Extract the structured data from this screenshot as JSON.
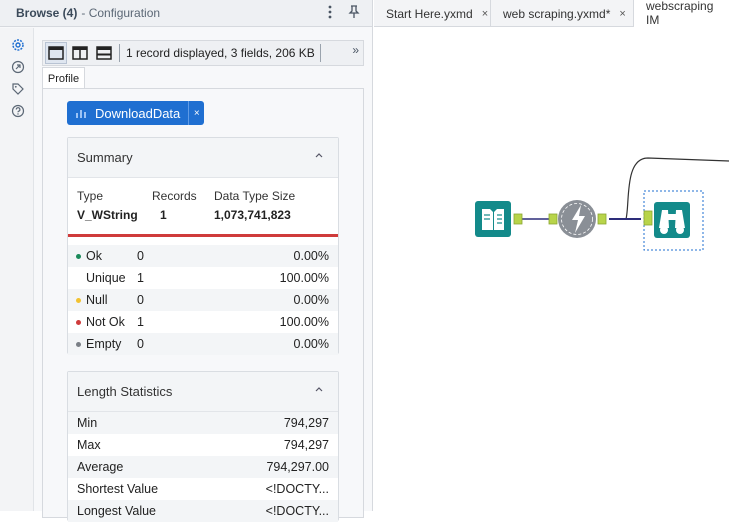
{
  "panel": {
    "title": "Browse (4)",
    "subtitle": "- Configuration",
    "menu_icon": "kebab-menu-icon",
    "pin_icon": "pin-icon"
  },
  "side_rail": {
    "icons": [
      "gear-icon",
      "tool-icon",
      "tag-icon",
      "help-icon"
    ]
  },
  "toolbar": {
    "records_text": "1 record displayed, 3 fields, 206 KB",
    "more_glyph": "»"
  },
  "profile": {
    "tab_label": "Profile",
    "field_name": "DownloadData",
    "close_glyph": "×",
    "summary": {
      "title": "Summary",
      "type_label": "Type",
      "type_value": "V_WString",
      "records_label": "Records",
      "records_value": "1",
      "size_label": "Data Type Size",
      "size_value": "1,073,741,823",
      "stats": [
        {
          "label": "Ok",
          "count": "0",
          "pct": "0.00%",
          "dot": "#1a8a5a"
        },
        {
          "label": "Unique",
          "count": "1",
          "pct": "100.00%",
          "dot": ""
        },
        {
          "label": "Null",
          "count": "0",
          "pct": "0.00%",
          "dot": "#f2c230"
        },
        {
          "label": "Not Ok",
          "count": "1",
          "pct": "100.00%",
          "dot": "#cf3b3b"
        },
        {
          "label": "Empty",
          "count": "0",
          "pct": "0.00%",
          "dot": "#7a7f86"
        }
      ]
    },
    "length": {
      "title": "Length Statistics",
      "rows": [
        {
          "label": "Min",
          "value": "794,297"
        },
        {
          "label": "Max",
          "value": "794,297"
        },
        {
          "label": "Average",
          "value": "794,297.00"
        },
        {
          "label": "Shortest Value",
          "value": "<!DOCTY..."
        },
        {
          "label": "Longest Value",
          "value": "<!DOCTY..."
        }
      ]
    }
  },
  "tabs": [
    {
      "label": "Start Here.yxmd",
      "close": "×"
    },
    {
      "label": "web scraping.yxmd*",
      "close": "×"
    },
    {
      "label": "webscraping IM",
      "close": ""
    }
  ],
  "colors": {
    "accent": "#1f6fd1",
    "tool_teal": "#138a8a",
    "tool_gray": "#8a8f96",
    "anchor_green": "#b8d44a",
    "connector": "#2d2d7a"
  },
  "workflow_tools": [
    "input-data-icon",
    "download-tool-icon",
    "browse-tool-icon"
  ]
}
